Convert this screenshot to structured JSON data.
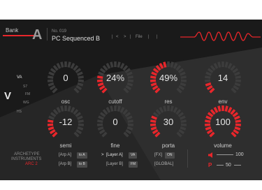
{
  "colors": {
    "accent": "#e8262b",
    "panel": "#262626",
    "panel_dark": "#1a1a1a",
    "tick_off": "#3c3c3c",
    "tick_on": "#e8262b"
  },
  "header": {
    "bank_label": "Bank",
    "bank_letter": "A",
    "preset_number": "No. 019",
    "preset_name": "PC Sequenced B",
    "nav_prev": "<",
    "nav_next": ">",
    "file_label": "File"
  },
  "waveform_selector": {
    "main_letter": "V",
    "options": [
      "VA",
      "S7",
      "FM",
      "WG",
      "HS"
    ],
    "selected": "VA"
  },
  "knobs": [
    {
      "id": "osc",
      "label": "osc",
      "value": "0",
      "level": 0.0
    },
    {
      "id": "cutoff",
      "label": "cutoff",
      "value": "24%",
      "level": 0.24
    },
    {
      "id": "res",
      "label": "res",
      "value": "49%",
      "level": 0.49
    },
    {
      "id": "env",
      "label": "env",
      "value": "14",
      "level": 0.14
    },
    {
      "id": "semi",
      "label": "semi",
      "value": "-12",
      "level": 0.25
    },
    {
      "id": "fine",
      "label": "fine",
      "value": "0",
      "level": 0.0
    },
    {
      "id": "porta",
      "label": "porta",
      "value": "30",
      "level": 0.3
    },
    {
      "id": "volume",
      "label": "volume",
      "value": "100",
      "level": 1.0
    }
  ],
  "footer": {
    "brand_line1": "ARCHETYPE",
    "brand_line2": "INSTRUMENTS",
    "brand_line3": "ARC 2",
    "arp_a_label": "[Arp A]",
    "arp_a_button": "to A",
    "arp_b_label": "[Arp B]",
    "arp_b_button": "to B",
    "layer_a_label": "[Layer A]",
    "layer_a_button": "VA",
    "layer_b_label": "[Layer B]",
    "layer_b_button": "FM",
    "fx_label": "[FX]",
    "fx_button": "ON",
    "global_label": "[GLOBAL]",
    "volume_value": "100",
    "pan_letter": "P",
    "pan_value": "50",
    "selected_marker": ">"
  }
}
